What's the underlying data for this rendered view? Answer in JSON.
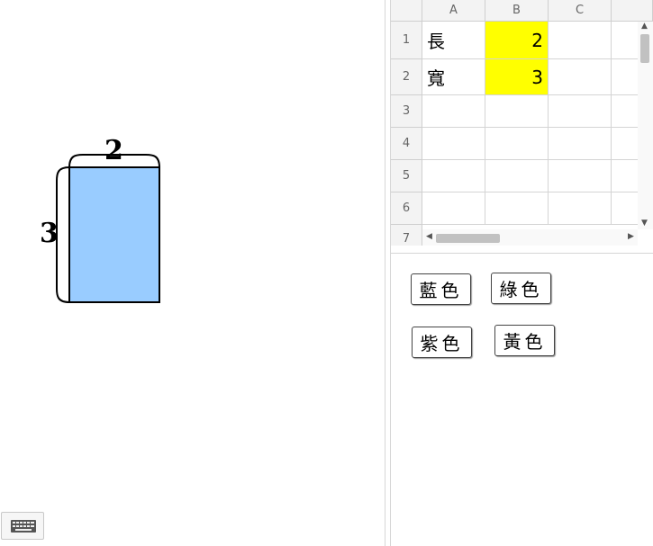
{
  "graphics": {
    "width_label": "2",
    "height_label": "3",
    "rect_fill": "#99ccff",
    "keyboard_icon": "keyboard-icon"
  },
  "spreadsheet": {
    "columns": [
      "A",
      "B",
      "C"
    ],
    "rows": [
      "1",
      "2",
      "3",
      "4",
      "5",
      "6",
      "7"
    ],
    "cells": {
      "A1": "長",
      "B1": "2",
      "A2": "寬",
      "B2": "3"
    },
    "highlight_color": "#ffff00"
  },
  "buttons": {
    "blue": "藍色",
    "green": "綠色",
    "purple": "紫色",
    "yellow": "黃色"
  }
}
